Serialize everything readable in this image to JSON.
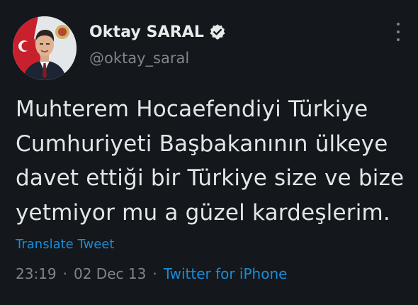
{
  "author": {
    "display_name": "Oktay SARAL",
    "handle": "@oktay_saral",
    "verified": true
  },
  "tweet": {
    "lines": [
      "Muhterem Hocaefendiyi Türkiye",
      "Cumhuriyeti Başbakanının ülkeye",
      "davet ettiği bir Türkiye size ve bize",
      "yetmiyor mu a güzel kardeşlerim."
    ],
    "translate_label": "Translate Tweet",
    "time": "23:19",
    "separator": "·",
    "date": "02 Dec 13",
    "source": "Twitter for iPhone"
  },
  "colors": {
    "background": "#14171b",
    "link": "#1a8cd8",
    "muted": "#7d858d",
    "verified_badge": "#e7e9ea"
  },
  "icons": {
    "more": "more-dots-icon",
    "verified": "verified-badge-icon"
  }
}
